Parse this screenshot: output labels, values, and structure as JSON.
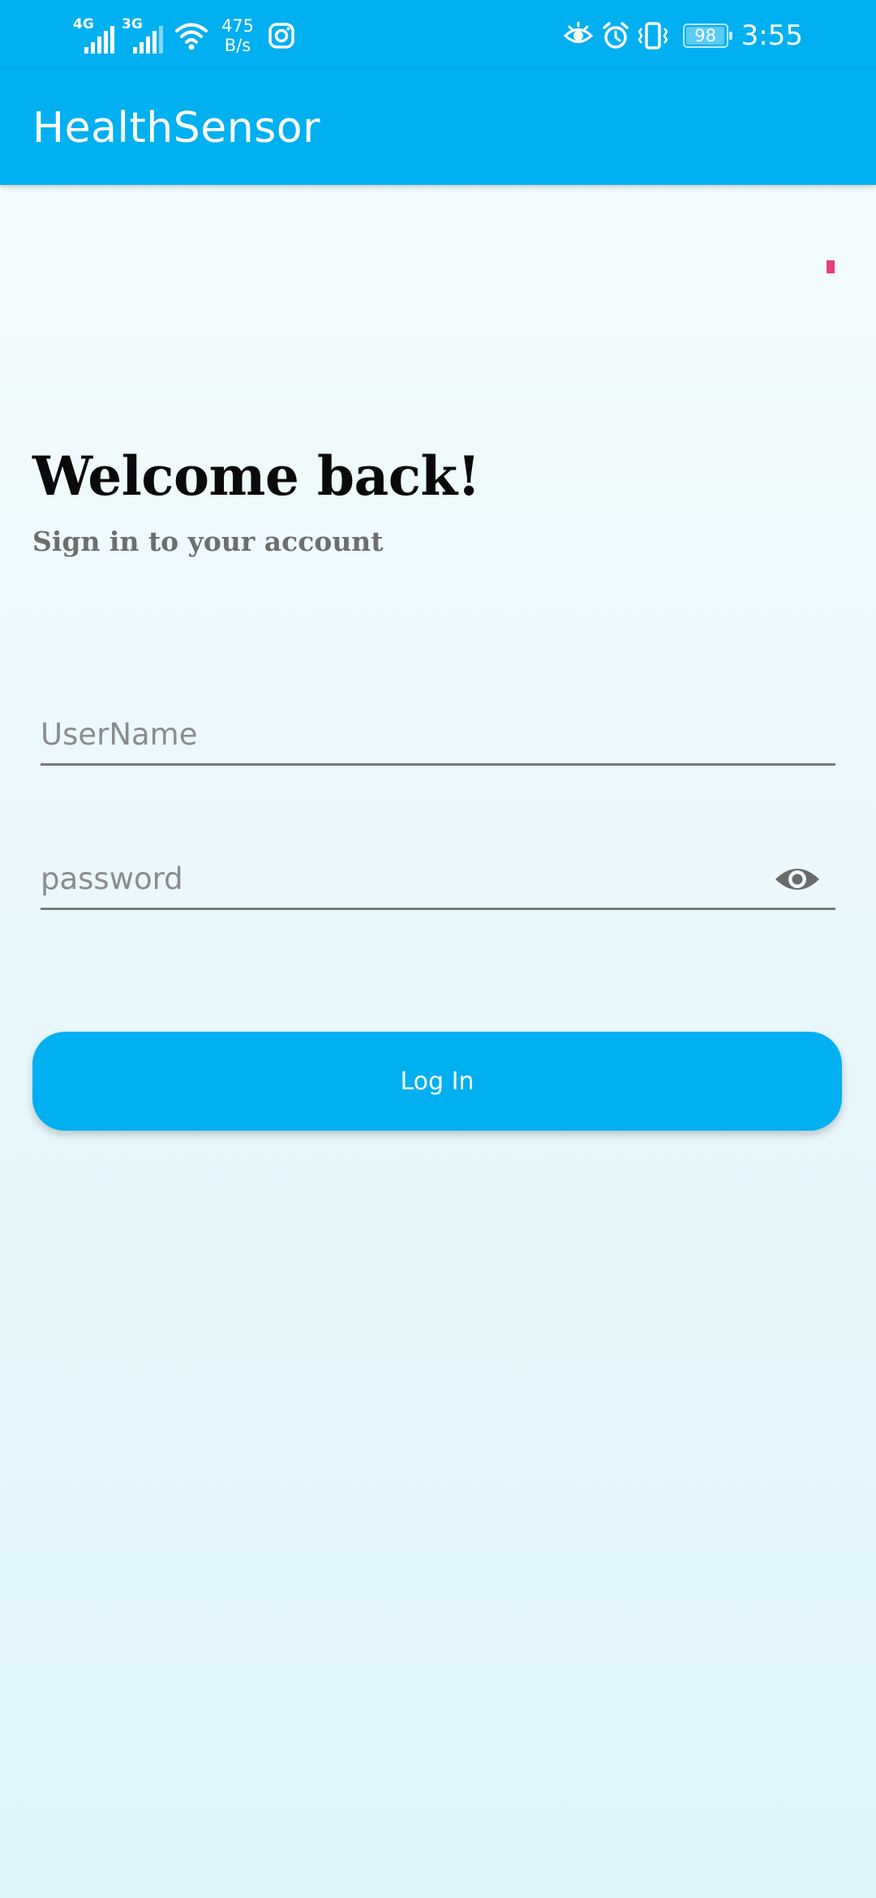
{
  "status_bar": {
    "signal_1_type": "4G",
    "signal_2_type": "3G",
    "net_speed_value": "475",
    "net_speed_unit": "B/s",
    "battery_level": "98",
    "time": "3:55",
    "icons": [
      "signal-icon",
      "signal-icon",
      "wifi-icon",
      "instagram-icon",
      "eye-comfort-icon",
      "alarm-icon",
      "vibrate-icon",
      "battery-icon"
    ]
  },
  "app_bar": {
    "title": "HealthSensor",
    "color": "#00b0f0"
  },
  "main": {
    "heading": "Welcome back!",
    "subheading": "Sign in to your account",
    "username": {
      "placeholder": "UserName",
      "value": ""
    },
    "password": {
      "placeholder": "password",
      "value": "",
      "toggle_icon": "eye-icon"
    },
    "login_button_label": "Log In"
  },
  "colors": {
    "accent": "#00b0f0",
    "debug_marker": "#e83e76"
  }
}
